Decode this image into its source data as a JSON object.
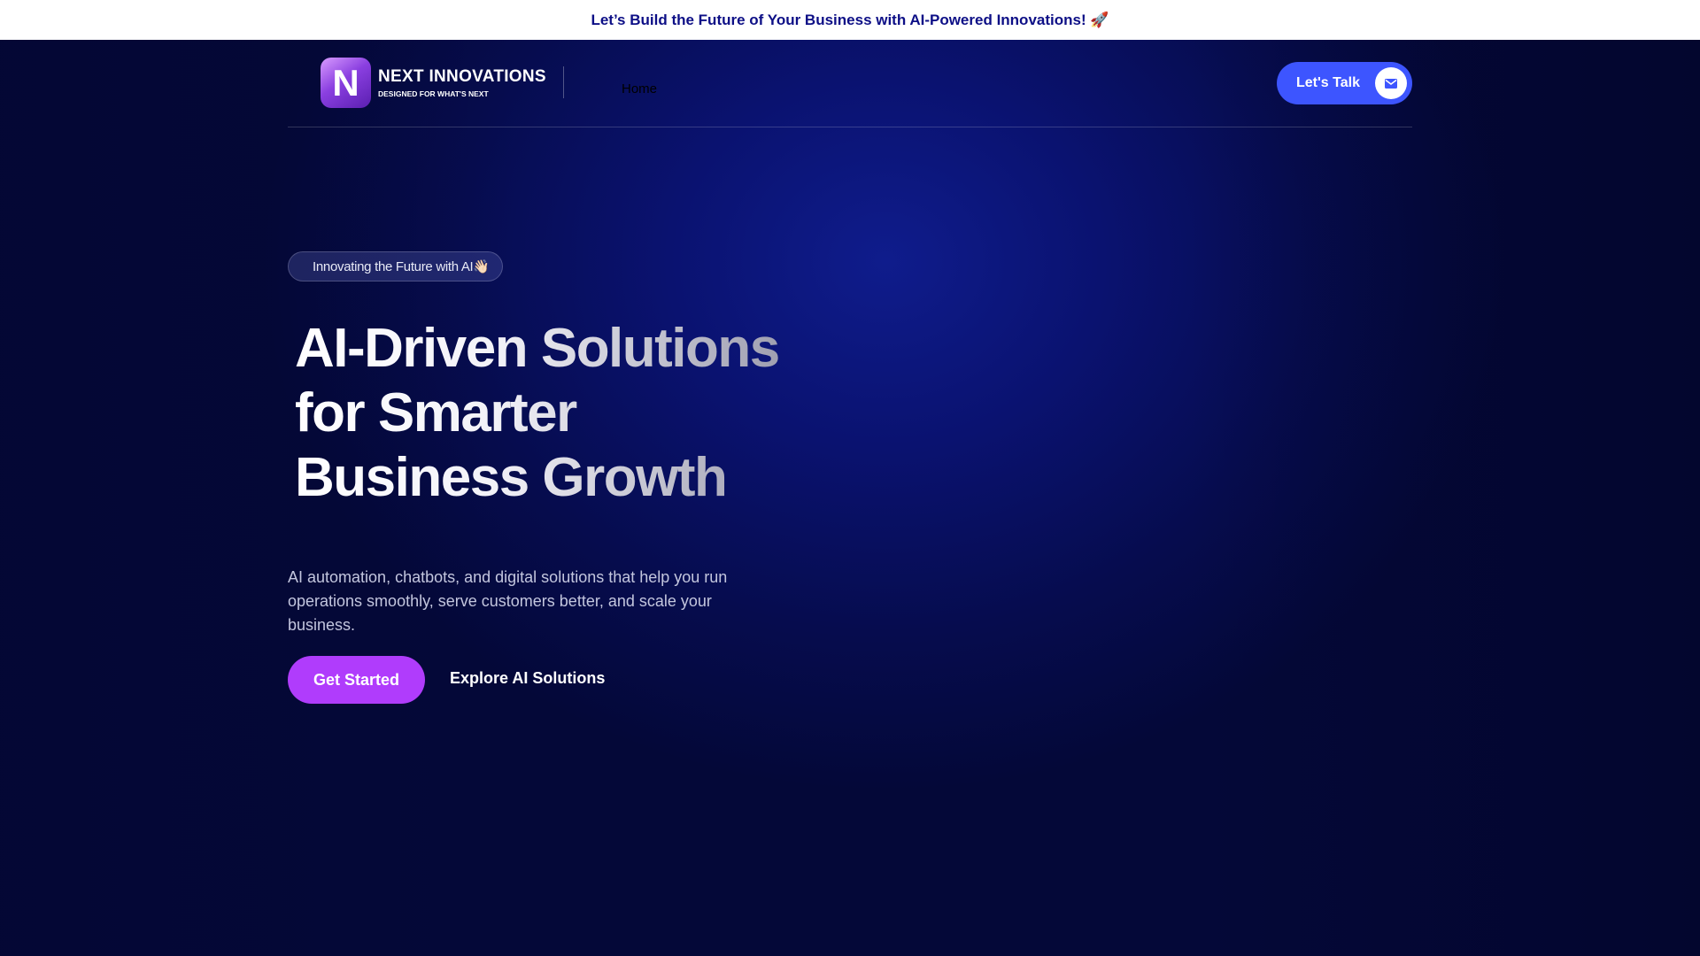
{
  "announcement": {
    "text": "Let’s Build the Future of Your Business with AI-Powered Innovations! 🚀"
  },
  "nav": {
    "logo_title": "NEXT INNOVATIONS",
    "logo_subtitle": "DESIGNED FOR WHAT'S NEXT",
    "logo_letter": "N",
    "items": [
      {
        "label": "Home"
      }
    ],
    "cta_label": "Let's Talk",
    "cta_icon": "mail-icon"
  },
  "hero": {
    "badge": "Innovating the Future with AI👋🏻",
    "headline_lines": [
      "AI-Driven Solutions",
      "for Smarter",
      "Business Growth"
    ],
    "description": "AI automation, chatbots, and digital solutions that help you run operations smoothly, serve customers better, and scale your business.",
    "primary_button": "Get Started",
    "secondary_button": "Explore AI Solutions"
  },
  "colors": {
    "accent_blue": "#3d55ff",
    "accent_purple": "#b03cfc",
    "background": "#040838",
    "announcement_text": "#0d0f86"
  }
}
